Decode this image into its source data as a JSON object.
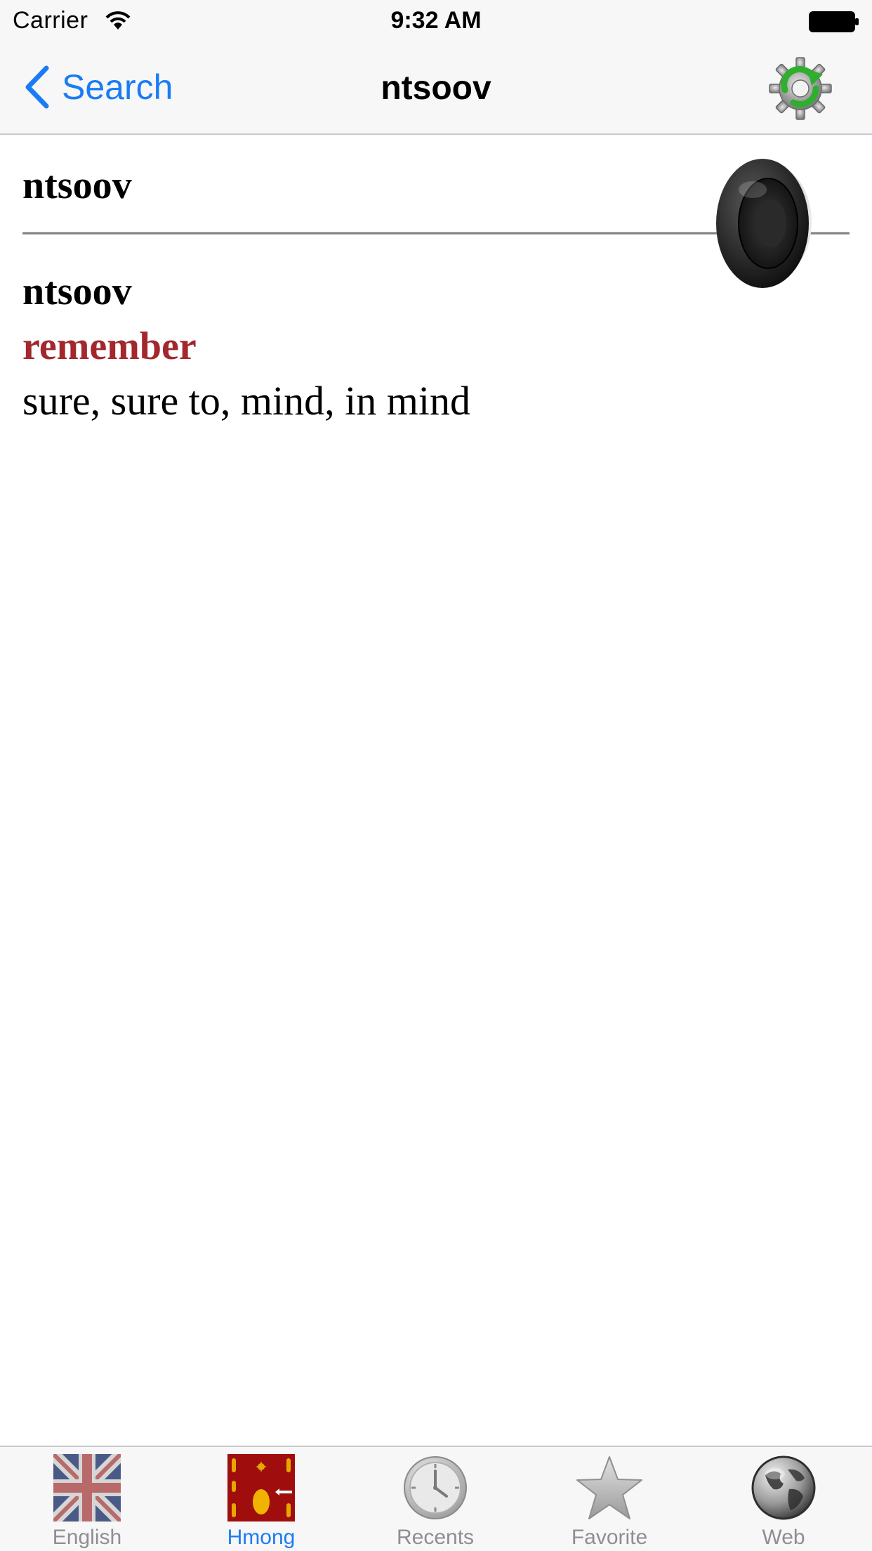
{
  "status_bar": {
    "carrier": "Carrier",
    "time": "9:32 AM"
  },
  "nav_bar": {
    "back_label": "Search",
    "title": "ntsoov",
    "right_icon": "settings-refresh-gear-icon"
  },
  "entry": {
    "headword": "ntsoov",
    "speaker_icon": "speaker-icon",
    "definition": {
      "word": "ntsoov",
      "meaning": "remember",
      "synonyms": "sure, sure to, mind, in mind"
    }
  },
  "tab_bar": {
    "active_index": 1,
    "tabs": [
      {
        "label": "English",
        "icon": "uk-flag-icon"
      },
      {
        "label": "Hmong",
        "icon": "hmong-flag-icon"
      },
      {
        "label": "Recents",
        "icon": "clock-icon"
      },
      {
        "label": "Favorite",
        "icon": "star-icon"
      },
      {
        "label": "Web",
        "icon": "globe-icon"
      }
    ]
  },
  "colors": {
    "tint": "#1a7cf5",
    "meaning": "#a3282d",
    "bar_background": "#f7f7f7",
    "inactive_tab": "#8e8e93"
  }
}
